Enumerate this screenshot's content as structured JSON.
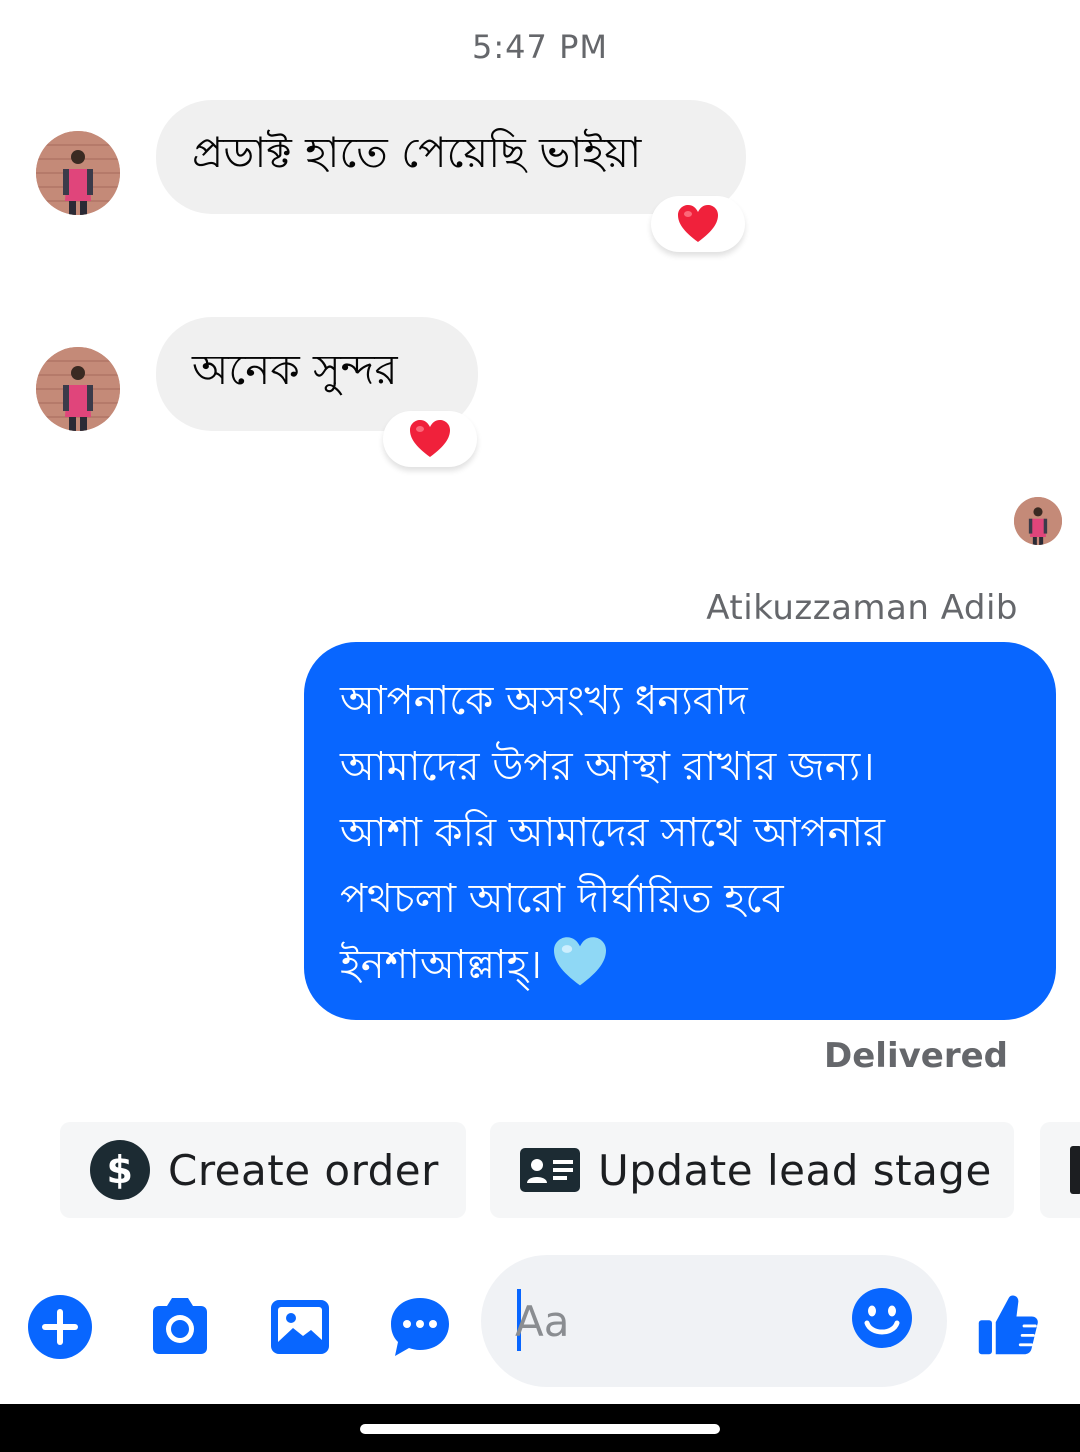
{
  "thread": {
    "timestamp": "5:47 PM"
  },
  "messages_in": [
    {
      "text": "প্রডাক্ট হাতে পেয়েছি ভাইয়া",
      "reaction": "red-heart"
    },
    {
      "text": "অনেক সুন্দর",
      "reaction": "red-heart"
    }
  ],
  "message_out": {
    "sender": "Atikuzzaman Adib",
    "lines": [
      "আপনাকে অসংখ্য ধন্যবাদ",
      "আমাদের উপর আস্থা রাখার জন্য।",
      "আশা করি আমাদের সাথে আপনার",
      "পথচলা আরো দীর্ঘায়িত হবে",
      "ইনশাআল্লাহ্।"
    ],
    "emoji": "light-blue-heart",
    "status": "Delivered"
  },
  "quick_actions": [
    {
      "label": "Create order",
      "icon": "dollar-circle-icon"
    },
    {
      "label": "Update lead stage",
      "icon": "id-card-icon"
    }
  ],
  "composer": {
    "placeholder": "Aa"
  },
  "toolbar": {
    "icons": [
      "plus-icon",
      "camera-icon",
      "gallery-icon",
      "chat-bubble-icon",
      "emoji-icon",
      "thumbs-up-icon"
    ]
  },
  "colors": {
    "accent": "#0866ff",
    "incoming_bubble": "#f0f0f0",
    "chip_bg": "#f5f6f7",
    "secondary_text": "#65676b"
  }
}
